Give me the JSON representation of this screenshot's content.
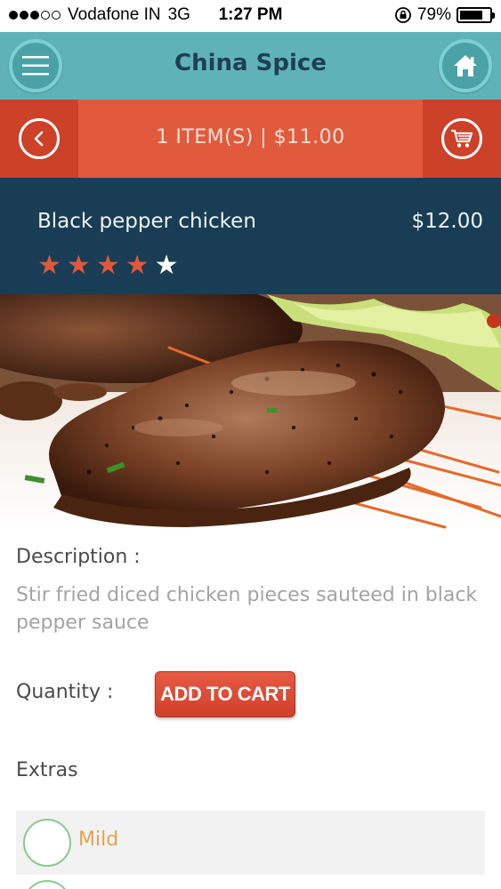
{
  "status_bar": {
    "carrier": "Vodafone IN",
    "network": "3G",
    "time": "1:27 PM",
    "battery_percent": "79%",
    "battery_level": 0.79,
    "signal_bars": 3,
    "signal_total": 5
  },
  "app": {
    "title": "China Spice"
  },
  "cart": {
    "summary": "1 ITEM(S) | $11.00"
  },
  "item": {
    "name": "Black pepper chicken",
    "price": "$12.00",
    "rating": 4,
    "rating_max": 5
  },
  "details": {
    "description_label": "Description :",
    "description_text": "Stir fried diced chicken pieces sauteed in black  pepper sauce",
    "quantity_label": "Quantity :",
    "add_to_cart_label": "ADD TO CART",
    "extras_label": "Extras",
    "extras": [
      {
        "label": "Mild"
      }
    ]
  },
  "colors": {
    "header_teal": "#5fb3b8",
    "title_navy": "#1f3f53",
    "cart_orange": "#e25a3c",
    "item_navy": "#183d55",
    "star_orange": "#e1573a",
    "radio_green": "#88c98f",
    "extra_orange": "#e6a24a"
  },
  "icons": {
    "menu": "hamburger-menu-icon",
    "home": "home-icon",
    "back": "chevron-left-icon",
    "cart": "shopping-cart-icon"
  }
}
